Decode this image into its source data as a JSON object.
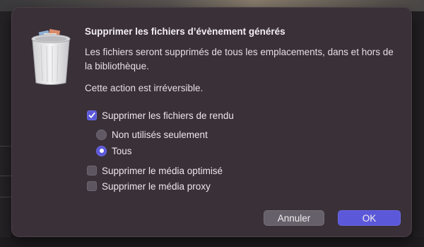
{
  "dialog": {
    "title": "Supprimer les fichiers d’évènement générés",
    "message": "Les fichiers seront supprimés de tous les emplacements, dans et hors de la bibliothèque.",
    "warning": "Cette action est irréversible.",
    "icon": "trash-icon"
  },
  "options": {
    "render_files": {
      "label": "Supprimer les fichiers de rendu",
      "checked": true
    },
    "render_scope": [
      {
        "label": "Non utilisés seulement",
        "selected": false
      },
      {
        "label": "Tous",
        "selected": true
      }
    ],
    "optimized_media": {
      "label": "Supprimer le média optimisé",
      "checked": false
    },
    "proxy_media": {
      "label": "Supprimer le média proxy",
      "checked": false
    }
  },
  "buttons": {
    "cancel": "Annuler",
    "ok": "OK"
  },
  "colors": {
    "dialog_bg": "#3a3038",
    "accent": "#5b58d9"
  }
}
